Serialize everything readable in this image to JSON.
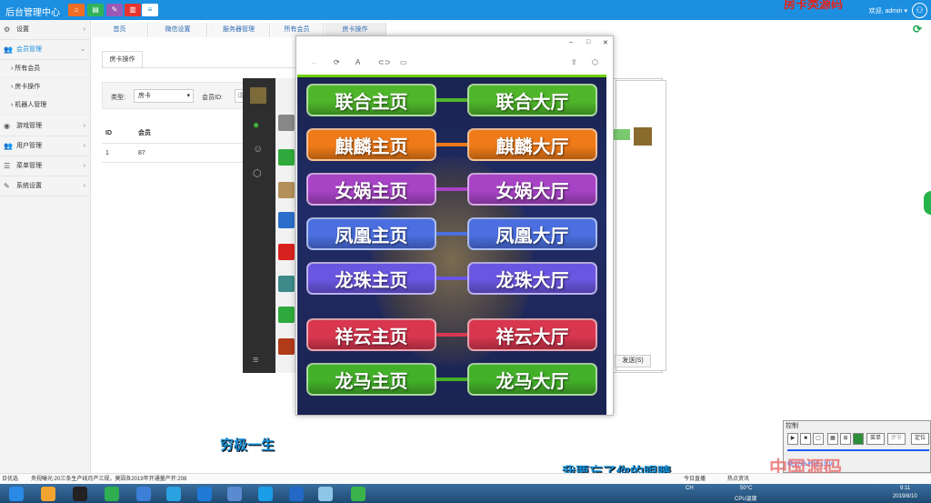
{
  "app": {
    "title": "后台管理中心",
    "welcome": "欢迎, admin ▾",
    "overlay_red": "房卡类源码"
  },
  "sidebar": {
    "items": [
      {
        "label": "设置"
      },
      {
        "label": "会员管理"
      },
      {
        "label": "游戏管理"
      },
      {
        "label": "用户管理"
      },
      {
        "label": "菜单管理"
      },
      {
        "label": "系统设置"
      }
    ],
    "sub": [
      {
        "label": "所有会员"
      },
      {
        "label": "房卡操作"
      },
      {
        "label": "机器人管理"
      }
    ]
  },
  "tabs": [
    {
      "label": "首页"
    },
    {
      "label": "微信设置"
    },
    {
      "label": "服务器管理"
    },
    {
      "label": "所有会员"
    },
    {
      "label": "房卡操作"
    }
  ],
  "content": {
    "subtab": "房卡操作",
    "filter": {
      "type_label": "类型:",
      "type_value": "房卡",
      "member_label": "会员ID:",
      "member_placeholder": "请"
    },
    "table": {
      "headers": [
        "ID",
        "会员"
      ],
      "rows": [
        [
          "1",
          "87"
        ]
      ]
    }
  },
  "chat": {
    "send_label": "发送(S)"
  },
  "game": {
    "buttons": [
      {
        "left": "联合主页",
        "right": "联合大厅",
        "color": "#4fb62a"
      },
      {
        "left": "麒麟主页",
        "right": "麒麟大厅",
        "color": "#ee7a18"
      },
      {
        "left": "女娲主页",
        "right": "女娲大厅",
        "color": "#a744c6"
      },
      {
        "left": "凤凰主页",
        "right": "凤凰大厅",
        "color": "#4b6fe0"
      },
      {
        "left": "龙珠主页",
        "right": "龙珠大厅",
        "color": "#6a56e0"
      },
      {
        "left": "祥云主页",
        "right": "祥云大厅",
        "color": "#d8374f"
      },
      {
        "left": "龙马主页",
        "right": "龙马大厅",
        "color": "#43b02a"
      }
    ]
  },
  "overlay": {
    "text1": "穷极一生",
    "text2": "我要忘了你的眼睛",
    "watermark": "中国源码"
  },
  "control": {
    "title": "控制",
    "menu": "菜单",
    "step": "步节",
    "locate": "定位",
    "status": "帧:2766 时间:13.10"
  },
  "statusline": {
    "left": "日优选",
    "news": "央视曝光:20三条生产线月产三规，莫因各2019年开通量产开:208",
    "live": "今日直播",
    "hot": "热点资讯"
  },
  "tray": {
    "temp": "50°C",
    "temp_label": "CPU温度",
    "time": "9:11",
    "date": "2019/8/10",
    "ch": "CH"
  }
}
